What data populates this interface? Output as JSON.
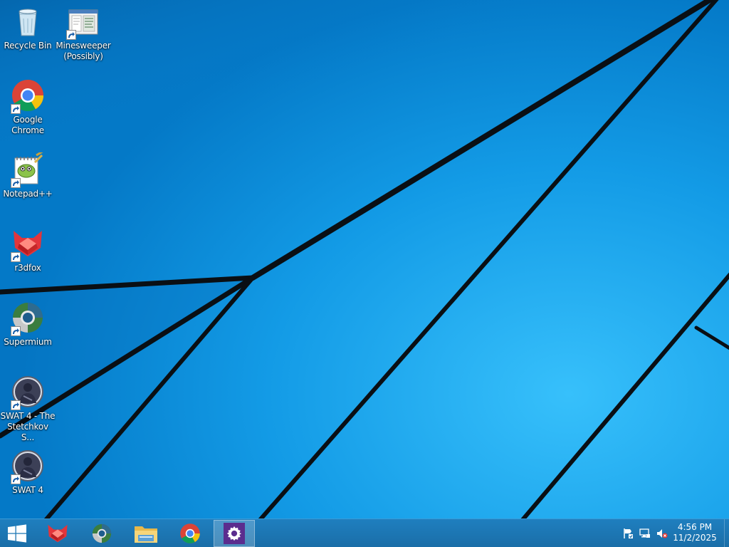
{
  "desktop": {
    "icons": [
      {
        "name": "recycle-bin",
        "label": "Recycle Bin",
        "icon": "recycle-bin-icon",
        "shortcut": false
      },
      {
        "name": "minesweeper",
        "label": "Minesweeper\n(Possibly)",
        "icon": "minesweeper-icon",
        "shortcut": true
      },
      {
        "name": "google-chrome",
        "label": "Google\nChrome",
        "icon": "chrome-icon",
        "shortcut": true
      },
      {
        "name": "notepad-plus-plus",
        "label": "Notepad++",
        "icon": "notepad-plus-plus-icon",
        "shortcut": true
      },
      {
        "name": "r3dfox",
        "label": "r3dfox",
        "icon": "r3dfox-icon",
        "shortcut": true
      },
      {
        "name": "supermium",
        "label": "Supermium",
        "icon": "supermium-icon",
        "shortcut": true
      },
      {
        "name": "swat4-stetchkov",
        "label": "SWAT 4 - The\nStetchkov S...",
        "icon": "swat4-icon",
        "shortcut": true
      },
      {
        "name": "swat4",
        "label": "SWAT 4",
        "icon": "swat4-icon",
        "shortcut": true
      }
    ]
  },
  "taskbar": {
    "start": {
      "icon": "windows-logo-icon"
    },
    "pinned": [
      {
        "name": "r3dfox",
        "icon": "r3dfox-icon",
        "active": false
      },
      {
        "name": "supermium",
        "icon": "supermium-icon",
        "active": false
      },
      {
        "name": "file-explorer",
        "icon": "folder-icon",
        "active": false
      },
      {
        "name": "google-chrome",
        "icon": "chrome-icon",
        "active": false
      },
      {
        "name": "settings",
        "icon": "gear-icon",
        "active": true
      }
    ],
    "tray": {
      "icons": [
        "action-center-flag-icon",
        "network-icon",
        "volume-muted-icon"
      ],
      "time": "4:56 PM",
      "date": "11/2/2025"
    }
  },
  "colors": {
    "wallpaper_blue": "#1196e4",
    "taskbar": "#1a6ea8",
    "chrome_red": "#db4437",
    "chrome_yellow": "#f4c20d",
    "chrome_green": "#0f9d58",
    "chrome_blue": "#4285f4",
    "r3dfox_red": "#e2353c",
    "settings_purple": "#5b2d8e"
  }
}
